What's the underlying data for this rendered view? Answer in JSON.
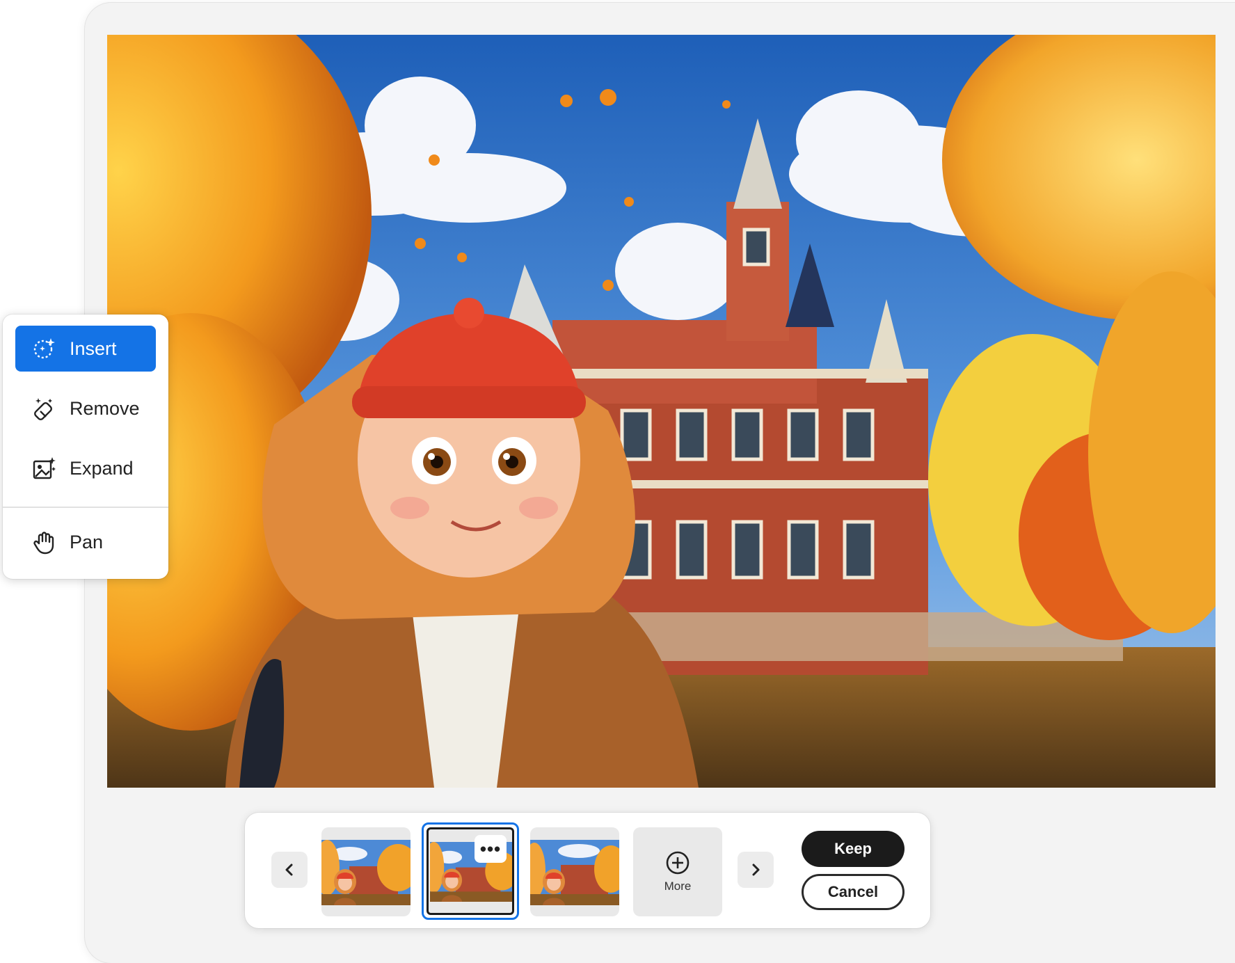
{
  "toolbar": {
    "items": [
      {
        "label": "Insert",
        "icon": "insert-sparkle-icon",
        "active": true
      },
      {
        "label": "Remove",
        "icon": "remove-eraser-icon",
        "active": false
      },
      {
        "label": "Expand",
        "icon": "expand-image-icon",
        "active": false
      },
      {
        "label": "Pan",
        "icon": "hand-icon",
        "active": false
      }
    ]
  },
  "variations": {
    "prev_icon": "chevron-left-icon",
    "next_icon": "chevron-right-icon",
    "selected_index": 1,
    "more_label": "More",
    "more_icon": "plus-circle-icon",
    "options_icon": "more-options-icon"
  },
  "actions": {
    "keep_label": "Keep",
    "cancel_label": "Cancel"
  },
  "colors": {
    "accent": "#1473e6",
    "primary_button": "#1b1b1b"
  }
}
